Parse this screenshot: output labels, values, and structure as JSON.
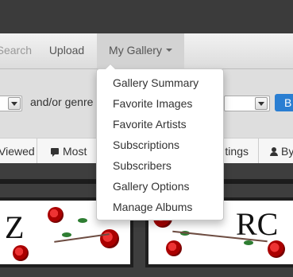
{
  "nav": {
    "search_label": "Search",
    "upload_label": "Upload",
    "gallery_label": "My Gallery"
  },
  "filters": {
    "genre_label": "and/or genre",
    "submit_label": "B"
  },
  "sort": {
    "viewed_label": "Viewed",
    "most_label": "Most C",
    "ratings_label": "tings",
    "by_label": "By"
  },
  "dropdown": {
    "items": [
      "Gallery Summary",
      "Favorite Images",
      "Favorite Artists",
      "Subscriptions",
      "Subscribers",
      "Gallery Options",
      "Manage Albums"
    ]
  },
  "thumbs": {
    "card1_text": "Z",
    "card2_text": "RC"
  },
  "colors": {
    "accent": "#2a7ed2",
    "rose_red": "#cc1111",
    "page_dark": "#3e3e3e"
  }
}
